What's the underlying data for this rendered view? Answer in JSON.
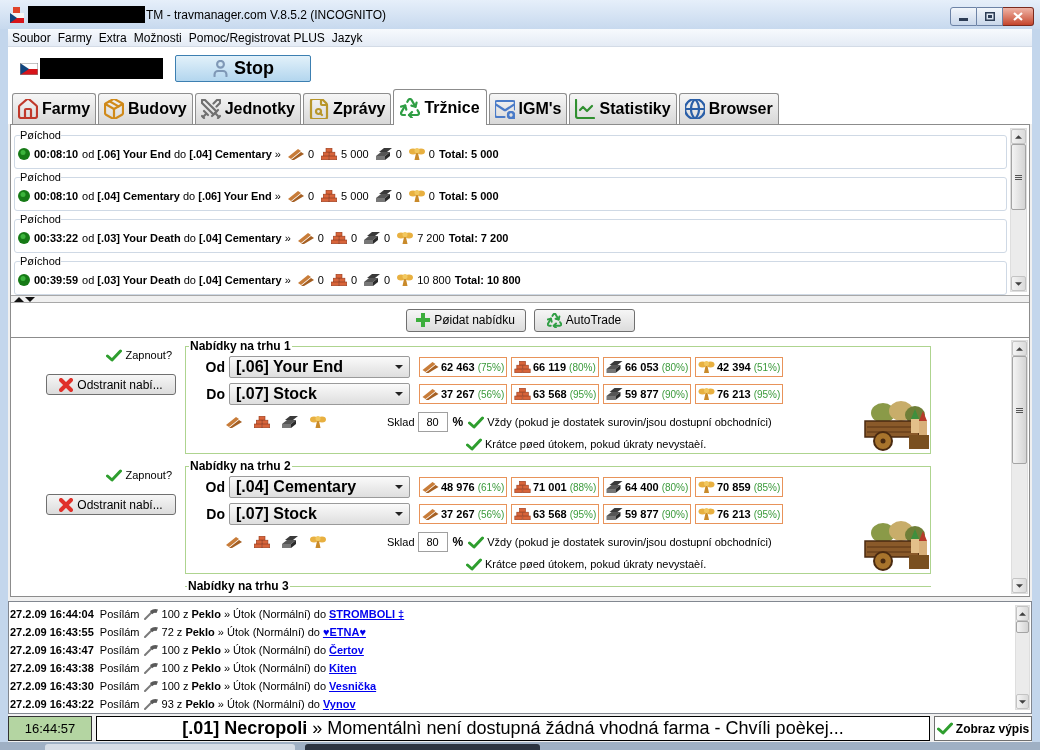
{
  "window": {
    "title": "TM - travmanager.com V.8.5.2 (INCOGNITO)"
  },
  "menu": [
    "Soubor",
    "Farmy",
    "Extra",
    "Možnosti",
    "Pomoc/Registrovat PLUS",
    "Jazyk"
  ],
  "toolbar": {
    "stop_button": "Stop"
  },
  "tabs": [
    {
      "label": "Farmy",
      "selected": false
    },
    {
      "label": "Budovy",
      "selected": false
    },
    {
      "label": "Jednotky",
      "selected": false
    },
    {
      "label": "Zprávy",
      "selected": false
    },
    {
      "label": "Tržnice",
      "selected": true
    },
    {
      "label": "IGM's",
      "selected": false
    },
    {
      "label": "Statistiky",
      "selected": false
    },
    {
      "label": "Browser",
      "selected": false
    }
  ],
  "arrivals": [
    {
      "heading": "Pøíchod",
      "time": "00:08:10",
      "route": "od **[.06] Your End** do **[.04] Cementary** »",
      "resources": [
        "0",
        "5 000",
        "0",
        "0"
      ],
      "total": "Total: 5 000"
    },
    {
      "heading": "Pøíchod",
      "time": "00:08:10",
      "route": "od **[.04] Cementary** do **[.06] Your End** »",
      "resources": [
        "0",
        "5 000",
        "0",
        "0"
      ],
      "total": "Total: 5 000"
    },
    {
      "heading": "Pøíchod",
      "time": "00:33:22",
      "route": "od **[.03] Your Death** do **[.04] Cementary** »",
      "resources": [
        "0",
        "0",
        "0",
        "7 200"
      ],
      "total": "Total: 7 200"
    },
    {
      "heading": "Pøíchod",
      "time": "00:39:59",
      "route": "od **[.03] Your Death** do **[.04] Cementary** »",
      "resources": [
        "0",
        "0",
        "0",
        "10 800"
      ],
      "total": "Total: 10 800"
    }
  ],
  "offer_toolbar": {
    "add_button": "Pøidat nabídku",
    "autotrade_button": "AutoTrade"
  },
  "offers": [
    {
      "enable": {
        "label": "Zapnout?",
        "checked": true
      },
      "remove_button": "Odstranit nabí...",
      "title": "Nabídky na trhu 1",
      "from": {
        "label": "Od",
        "value": "[.06] Your End",
        "stock": [
          {
            "amount": "62 463",
            "percent": "(75%)"
          },
          {
            "amount": "66 119",
            "percent": "(80%)"
          },
          {
            "amount": "66 053",
            "percent": "(80%)"
          },
          {
            "amount": "42 394",
            "percent": "(51%)"
          }
        ]
      },
      "to": {
        "label": "Do",
        "value": "[.07] Stock",
        "stock": [
          {
            "amount": "37 267",
            "percent": "(56%)"
          },
          {
            "amount": "63 568",
            "percent": "(95%)"
          },
          {
            "amount": "59 877",
            "percent": "(90%)"
          },
          {
            "amount": "76 213",
            "percent": "(95%)"
          }
        ]
      },
      "storage": {
        "label": "Sklad",
        "value": "80",
        "unit": "%"
      },
      "options": [
        {
          "label": "Vždy (pokud je dostatek surovin/jsou dostupní obchodníci)",
          "checked": true
        },
        {
          "label": "Krátce pøed útokem, pokud úkraty nevystaèí.",
          "checked": true
        }
      ]
    },
    {
      "enable": {
        "label": "Zapnout?",
        "checked": true
      },
      "remove_button": "Odstranit nabí...",
      "title": "Nabídky na trhu 2",
      "from": {
        "label": "Od",
        "value": "[.04] Cementary",
        "stock": [
          {
            "amount": "48 976",
            "percent": "(61%)"
          },
          {
            "amount": "71 001",
            "percent": "(88%)"
          },
          {
            "amount": "64 400",
            "percent": "(80%)"
          },
          {
            "amount": "70 859",
            "percent": "(85%)"
          }
        ]
      },
      "to": {
        "label": "Do",
        "value": "[.07] Stock",
        "stock": [
          {
            "amount": "37 267",
            "percent": "(56%)"
          },
          {
            "amount": "63 568",
            "percent": "(95%)"
          },
          {
            "amount": "59 877",
            "percent": "(90%)"
          },
          {
            "amount": "76 213",
            "percent": "(95%)"
          }
        ]
      },
      "storage": {
        "label": "Sklad",
        "value": "80",
        "unit": "%"
      },
      "options": [
        {
          "label": "Vždy (pokud je dostatek surovin/jsou dostupní obchodníci)",
          "checked": true
        },
        {
          "label": "Krátce pøed útokem, pokud úkraty nevystaèí.",
          "checked": true
        }
      ]
    },
    {
      "title": "Nabídky na trhu 3"
    }
  ],
  "log": [
    {
      "timestamp": "27.2.09 16:44:04",
      "verb": "Posílám",
      "detail": "100 z **Peklo** » Útok (Normální) do",
      "target": "STROMBOLI ‡"
    },
    {
      "timestamp": "27.2.09 16:43:55",
      "verb": "Posílám",
      "detail": "72 z **Peklo** » Útok (Normální) do",
      "target": "♥ETNA♥"
    },
    {
      "timestamp": "27.2.09 16:43:47",
      "verb": "Posílám",
      "detail": "100 z **Peklo** » Útok (Normální) do",
      "target": "Čertov"
    },
    {
      "timestamp": "27.2.09 16:43:38",
      "verb": "Posílám",
      "detail": "100 z **Peklo** » Útok (Normální) do",
      "target": "Kiten"
    },
    {
      "timestamp": "27.2.09 16:43:30",
      "verb": "Posílám",
      "detail": "100 z **Peklo** » Útok (Normální) do",
      "target": "Vesnička"
    },
    {
      "timestamp": "27.2.09 16:43:22",
      "verb": "Posílám",
      "detail": "93 z **Peklo** » Útok (Normální) do",
      "target": "Vynov"
    }
  ],
  "status_bar": {
    "time": "16:44:57",
    "message": "**[.01] Necropoli** » Momentálnì není dostupná žádná vhodná farma - Chvíli poèkej...",
    "button": "Zobraz výpis"
  }
}
